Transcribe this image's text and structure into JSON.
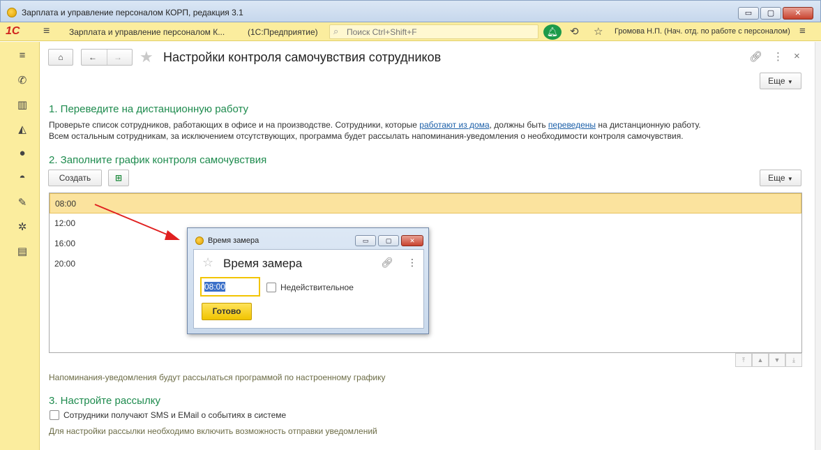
{
  "window": {
    "title": "Зарплата и управление персоналом КОРП, редакция 3.1",
    "minimize": "▭",
    "maximize": "▢",
    "close": "✕"
  },
  "topbar": {
    "logo": "1С",
    "app_title": "Зарплата и управление персоналом К...",
    "mode": "(1С:Предприятие)",
    "search_placeholder": "Поиск Ctrl+Shift+F",
    "user": "Громова Н.П. (Нач. отд. по работе с персоналом)",
    "icons": [
      "menu-icon",
      "search-icon",
      "bell-icon",
      "history-icon",
      "star-icon",
      "settings-menu-icon"
    ]
  },
  "sidebar": {
    "icons": [
      "menu-icon",
      "phone-icon",
      "gift-icon",
      "graduation-cap-icon",
      "users-icon",
      "helmet-icon",
      "wrench-icon",
      "gear-icon",
      "id-card-icon"
    ]
  },
  "form": {
    "title": "Настройки контроля самочувствия сотрудников",
    "more_label": "Еще",
    "section1": {
      "heading": "1. Переведите на дистанционную работу",
      "line1_a": "Проверьте список сотрудников, работающих в офисе и на производстве. Сотрудники, которые ",
      "link1": "работают из дома",
      "line1_b": ", должны быть ",
      "link2": "переведены",
      "line1_c": " на дистанционную работу.",
      "line2": "Всем остальным сотрудникам, за исключением отсутствующих, программа будет рассылать напоминания-уведомления о необходимости контроля самочувствия."
    },
    "section2": {
      "heading": "2. Заполните график контроля самочувствия",
      "create_label": "Создать",
      "more_label": "Еще",
      "times": [
        "08:00",
        "12:00",
        "16:00",
        "20:00"
      ],
      "note": "Напоминания-уведомления будут рассылаться программой по настроенному графику"
    },
    "section3": {
      "heading": "3. Настройте рассылку",
      "checkbox_label": "Сотрудники получают SMS и EMail о событиях в системе",
      "checkbox_checked": false,
      "note": "Для настройки рассылки необходимо включить возможность отправки уведомлений"
    }
  },
  "popup": {
    "window_title": "Время замера",
    "title": "Время замера",
    "time_value": "08:00",
    "invalid_label": "Недействительное",
    "invalid_checked": false,
    "ready_label": "Готово"
  },
  "colors": {
    "accent_yellow": "#fbed9e",
    "section_green": "#1e8b4e",
    "selected_row": "#fbe39e",
    "arrow_red": "#e02020"
  }
}
